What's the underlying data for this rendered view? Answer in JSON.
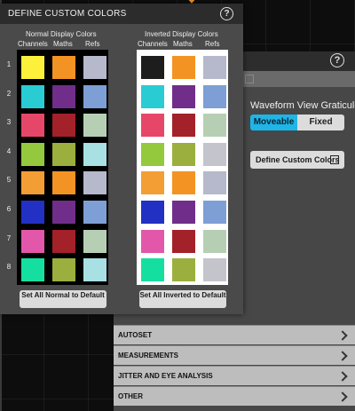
{
  "dialog": {
    "title": "DEFINE CUSTOM COLORS",
    "help": "?",
    "normal": {
      "title": "Normal Display Colors",
      "columns": [
        "Channels",
        "Maths",
        "Refs"
      ],
      "rows": [
        [
          "#fcf03a",
          "#f39324",
          "#b6b8cb"
        ],
        [
          "#29ccd3",
          "#702e8a",
          "#7e9fd6"
        ],
        [
          "#e64768",
          "#a32128",
          "#b6cfb4"
        ],
        [
          "#94c93d",
          "#9aaf3d",
          "#a8e0e3"
        ],
        [
          "#f39e35",
          "#f39324",
          "#b6b8cb"
        ],
        [
          "#2230c4",
          "#702e8a",
          "#7e9fd6"
        ],
        [
          "#e257a9",
          "#a32128",
          "#b6cfb4"
        ],
        [
          "#15dfa0",
          "#9aaf3d",
          "#a8e0e3"
        ]
      ],
      "default_button": "Set All Normal to Default"
    },
    "inverted": {
      "title": "Inverted Display Colors",
      "columns": [
        "Channels",
        "Maths",
        "Refs"
      ],
      "rows": [
        [
          "#1d1d1d",
          "#f39324",
          "#b6b8cb"
        ],
        [
          "#29ccd3",
          "#702e8a",
          "#7e9fd6"
        ],
        [
          "#e64768",
          "#a32128",
          "#b6cfb4"
        ],
        [
          "#94c93d",
          "#9aaf3d",
          "#c4c4cc"
        ],
        [
          "#f39e35",
          "#f39324",
          "#b6b8cb"
        ],
        [
          "#2230c4",
          "#702e8a",
          "#7e9fd6"
        ],
        [
          "#e257a9",
          "#a32128",
          "#b6cfb4"
        ],
        [
          "#15dfa0",
          "#9aaf3d",
          "#c4c4cc"
        ]
      ],
      "default_button": "Set All Inverted to Default"
    },
    "row_numbers": [
      "1",
      "2",
      "3",
      "4",
      "5",
      "6",
      "7",
      "8"
    ]
  },
  "back_panel": {
    "help": "?",
    "graticule_label": "Waveform View Graticule",
    "graticule_options": [
      "Moveable",
      "Fixed"
    ],
    "graticule_selected": "Moveable",
    "define_button": "Define Custom Colors",
    "accordion": [
      "AUTOSET",
      "MEASUREMENTS",
      "JITTER AND EYE ANALYSIS",
      "OTHER"
    ]
  },
  "colors": {
    "toggle_active": "#1fb5e6",
    "marker": "#f7941d",
    "waveform": "#c8c832"
  }
}
